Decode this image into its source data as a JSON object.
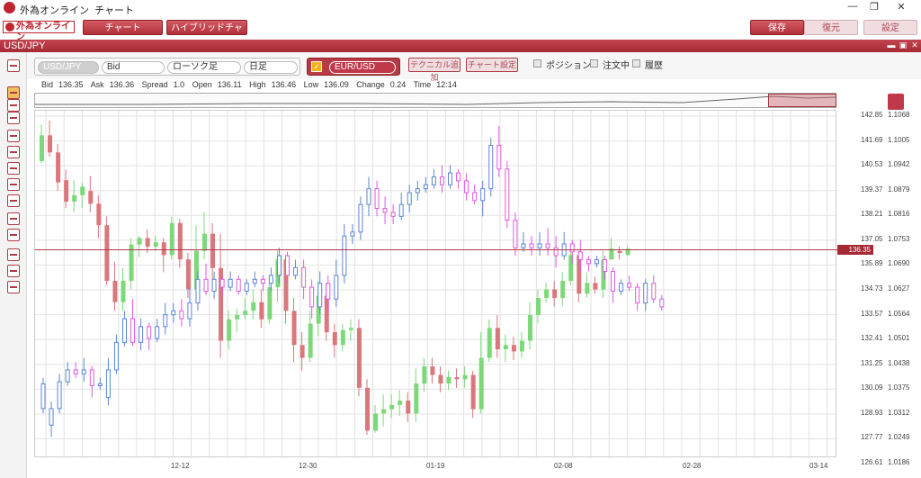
{
  "window": {
    "brand": "外為オンライン",
    "title": "チャート",
    "minimize": "—",
    "maximize": "❐",
    "close": "✕"
  },
  "toolbar": {
    "logo_text": "外為オンライン",
    "chart_tab": "チャート",
    "hybrid_tab": "ハイブリッドチャート",
    "save": "保存",
    "restore": "復元",
    "settings": "設定"
  },
  "chart_window": {
    "title": "USD/JPY"
  },
  "options": {
    "pair": "USD/JPY",
    "price_side": "Bid",
    "chart_type": "ローソク足",
    "period": "日足",
    "compare_pair": "EUR/USD",
    "add_technical": "テクニカル追加",
    "chart_settings": "チャート設定",
    "position": "ポジション",
    "orders": "注文中",
    "history": "履歴"
  },
  "info": {
    "bid_label": "Bid",
    "bid": "136.35",
    "ask_label": "Ask",
    "ask": "136.36",
    "spread_label": "Spread",
    "spread": "1.0",
    "open_label": "Open",
    "open": "136.11",
    "high_label": "High",
    "high": "136.46",
    "low_label": "Low",
    "low": "136.09",
    "change_label": "Change",
    "change": "0.24",
    "time_label": "Time",
    "time": "12:14"
  },
  "current_price": "136.35",
  "colors": {
    "up": "#7dd87a",
    "down": "#d9777c",
    "compare_up": "#5b86d6",
    "compare_down": "#e05ae0",
    "price_line": "#b03a4a"
  },
  "chart_data": {
    "type": "candlestick",
    "x_ticks": [
      "12-12",
      "12-30",
      "01-19",
      "02-08",
      "02-28",
      "03-14"
    ],
    "y_left_ticks": [
      "142.85",
      "141.69",
      "140.53",
      "139.37",
      "138.21",
      "137.05",
      "135.89",
      "134.73",
      "133.57",
      "132.41",
      "131.25",
      "130.09",
      "128.93",
      "127.77",
      "126.61"
    ],
    "y_right_ticks": [
      "1.1068",
      "1.1005",
      "1.0942",
      "1.0879",
      "1.0816",
      "1.0753",
      "1.0690",
      "1.0627",
      "1.0564",
      "1.0501",
      "1.0438",
      "1.0375",
      "1.0312",
      "1.0249",
      "1.0186"
    ],
    "ylim": [
      126.61,
      142.85
    ],
    "usdjpy": [
      [
        140.5,
        141.7,
        142.2,
        140.4
      ],
      [
        141.7,
        140.9,
        142.4,
        140.7
      ],
      [
        140.9,
        139.5,
        141.3,
        139.1
      ],
      [
        139.6,
        138.6,
        140.1,
        138.3
      ],
      [
        138.6,
        138.9,
        139.6,
        138.1
      ],
      [
        138.9,
        139.3,
        139.5,
        138.3
      ],
      [
        139.1,
        138.5,
        139.8,
        138.1
      ],
      [
        138.5,
        137.5,
        138.9,
        136.9
      ],
      [
        137.5,
        134.9,
        137.9,
        134.7
      ],
      [
        134.9,
        133.9,
        135.8,
        133.5
      ],
      [
        133.9,
        134.9,
        135.5,
        133.5
      ],
      [
        134.9,
        136.6,
        136.9,
        134.5
      ],
      [
        136.6,
        136.9,
        137.0,
        136.0
      ],
      [
        136.9,
        136.5,
        137.3,
        136.2
      ],
      [
        136.5,
        136.7,
        137.0,
        136.3
      ],
      [
        136.7,
        136.1,
        136.9,
        135.3
      ],
      [
        136.1,
        137.6,
        137.9,
        135.9
      ],
      [
        137.6,
        135.9,
        137.8,
        135.5
      ],
      [
        135.9,
        134.5,
        136.2,
        134.1
      ],
      [
        134.5,
        136.3,
        137.5,
        134.3
      ],
      [
        136.3,
        137.1,
        138.1,
        135.9
      ],
      [
        137.1,
        135.5,
        137.6,
        134.5
      ],
      [
        135.5,
        132.1,
        137.1,
        131.3
      ],
      [
        132.1,
        133.1,
        133.5,
        131.7
      ],
      [
        133.1,
        133.3,
        133.6,
        132.5
      ],
      [
        133.3,
        133.5,
        134.1,
        133.1
      ],
      [
        133.5,
        133.9,
        134.5,
        133.1
      ],
      [
        133.9,
        133.1,
        134.5,
        132.7
      ],
      [
        133.1,
        134.6,
        135.1,
        132.9
      ],
      [
        134.6,
        135.9,
        136.3,
        133.9
      ],
      [
        135.9,
        133.5,
        136.1,
        132.9
      ],
      [
        133.5,
        131.9,
        134.1,
        131.1
      ],
      [
        131.9,
        131.3,
        132.5,
        130.7
      ],
      [
        131.3,
        132.9,
        133.5,
        131.1
      ],
      [
        132.9,
        134.2,
        134.9,
        132.3
      ],
      [
        134.2,
        132.5,
        134.8,
        132.1
      ],
      [
        132.5,
        131.9,
        132.9,
        131.3
      ],
      [
        131.9,
        132.6,
        132.9,
        131.6
      ],
      [
        132.6,
        132.7,
        133.1,
        132.1
      ],
      [
        132.7,
        129.9,
        133.1,
        129.5
      ],
      [
        129.9,
        127.9,
        130.3,
        127.7
      ],
      [
        127.9,
        128.7,
        129.1,
        127.8
      ],
      [
        128.7,
        128.9,
        129.6,
        128.1
      ],
      [
        128.9,
        129.1,
        129.6,
        128.5
      ],
      [
        129.1,
        129.3,
        129.8,
        128.6
      ],
      [
        129.3,
        128.7,
        129.7,
        128.3
      ],
      [
        128.7,
        130.1,
        130.8,
        128.3
      ],
      [
        130.1,
        130.9,
        131.3,
        129.7
      ],
      [
        130.9,
        130.5,
        131.3,
        130.1
      ],
      [
        130.5,
        130.1,
        130.9,
        129.7
      ],
      [
        130.1,
        130.4,
        130.7,
        129.8
      ],
      [
        130.4,
        130.3,
        130.8,
        129.9
      ],
      [
        130.3,
        130.5,
        130.9,
        129.9
      ],
      [
        130.5,
        128.9,
        130.7,
        128.5
      ],
      [
        128.9,
        131.3,
        132.5,
        128.7
      ],
      [
        131.3,
        132.7,
        133.1,
        131.1
      ],
      [
        132.7,
        131.7,
        133.3,
        131.3
      ],
      [
        131.7,
        131.9,
        132.4,
        131.1
      ],
      [
        131.9,
        131.6,
        132.3,
        131.2
      ],
      [
        131.6,
        132.1,
        132.5,
        131.3
      ],
      [
        132.1,
        133.3,
        133.9,
        131.7
      ],
      [
        133.3,
        134.1,
        134.5,
        132.9
      ],
      [
        134.1,
        134.5,
        134.8,
        133.9
      ],
      [
        134.5,
        134.1,
        134.9,
        133.7
      ],
      [
        134.1,
        134.9,
        135.3,
        133.7
      ],
      [
        134.9,
        136.1,
        136.3,
        134.7
      ],
      [
        136.1,
        134.3,
        136.3,
        133.9
      ],
      [
        134.3,
        134.8,
        135.3,
        134.1
      ],
      [
        134.8,
        134.5,
        135.1,
        134.3
      ],
      [
        134.5,
        135.9,
        136.3,
        134.1
      ],
      [
        135.9,
        136.4,
        136.9,
        135.9
      ],
      [
        136.3,
        136.2,
        136.5,
        135.9
      ],
      [
        136.1,
        136.4,
        136.5,
        136.1
      ]
    ],
    "eurusd": [
      [
        1.0312,
        1.0375,
        1.039,
        1.03
      ],
      [
        1.027,
        1.0312,
        1.033,
        1.024
      ],
      [
        1.0312,
        1.038,
        1.04,
        1.03
      ],
      [
        1.038,
        1.041,
        1.043,
        1.037
      ],
      [
        1.041,
        1.04,
        1.043,
        1.039
      ],
      [
        1.04,
        1.041,
        1.044,
        1.038
      ],
      [
        1.041,
        1.037,
        1.042,
        1.034
      ],
      [
        1.037,
        1.0375,
        1.039,
        1.036
      ],
      [
        1.034,
        1.041,
        1.044,
        1.032
      ],
      [
        1.041,
        1.048,
        1.05,
        1.04
      ],
      [
        1.048,
        1.054,
        1.056,
        1.047
      ],
      [
        1.054,
        1.048,
        1.059,
        1.047
      ],
      [
        1.048,
        1.052,
        1.054,
        1.046
      ],
      [
        1.052,
        1.049,
        1.053,
        1.046
      ],
      [
        1.049,
        1.052,
        1.054,
        1.048
      ],
      [
        1.052,
        1.055,
        1.058,
        1.05
      ],
      [
        1.055,
        1.056,
        1.058,
        1.053
      ],
      [
        1.056,
        1.054,
        1.059,
        1.052
      ],
      [
        1.054,
        1.058,
        1.062,
        1.052
      ],
      [
        1.058,
        1.064,
        1.066,
        1.056
      ],
      [
        1.064,
        1.061,
        1.068,
        1.06
      ],
      [
        1.061,
        1.064,
        1.066,
        1.059
      ],
      [
        1.064,
        1.062,
        1.065,
        1.06
      ],
      [
        1.062,
        1.064,
        1.066,
        1.061
      ],
      [
        1.064,
        1.061,
        1.065,
        1.06
      ],
      [
        1.061,
        1.063,
        1.064,
        1.06
      ],
      [
        1.063,
        1.064,
        1.066,
        1.062
      ],
      [
        1.064,
        1.063,
        1.065,
        1.061
      ],
      [
        1.063,
        1.065,
        1.067,
        1.061
      ],
      [
        1.065,
        1.07,
        1.072,
        1.063
      ],
      [
        1.07,
        1.065,
        1.071,
        1.063
      ],
      [
        1.065,
        1.067,
        1.069,
        1.064
      ],
      [
        1.067,
        1.062,
        1.069,
        1.059
      ],
      [
        1.062,
        1.057,
        1.064,
        1.054
      ],
      [
        1.057,
        1.063,
        1.066,
        1.055
      ],
      [
        1.063,
        1.059,
        1.065,
        1.056
      ],
      [
        1.059,
        1.065,
        1.069,
        1.057
      ],
      [
        1.065,
        1.075,
        1.078,
        1.063
      ],
      [
        1.075,
        1.076,
        1.078,
        1.073
      ],
      [
        1.076,
        1.083,
        1.085,
        1.074
      ],
      [
        1.083,
        1.087,
        1.09,
        1.08
      ],
      [
        1.087,
        1.082,
        1.089,
        1.08
      ],
      [
        1.082,
        1.081,
        1.085,
        1.078
      ],
      [
        1.081,
        1.08,
        1.083,
        1.078
      ],
      [
        1.08,
        1.083,
        1.086,
        1.079
      ],
      [
        1.083,
        1.086,
        1.088,
        1.081
      ],
      [
        1.086,
        1.087,
        1.089,
        1.084
      ],
      [
        1.087,
        1.088,
        1.09,
        1.086
      ],
      [
        1.088,
        1.09,
        1.092,
        1.087
      ],
      [
        1.09,
        1.088,
        1.093,
        1.086
      ],
      [
        1.088,
        1.091,
        1.093,
        1.087
      ],
      [
        1.091,
        1.089,
        1.092,
        1.087
      ],
      [
        1.089,
        1.086,
        1.091,
        1.084
      ],
      [
        1.086,
        1.084,
        1.088,
        1.083
      ],
      [
        1.084,
        1.087,
        1.089,
        1.08
      ],
      [
        1.087,
        1.098,
        1.1,
        1.085
      ],
      [
        1.098,
        1.092,
        1.103,
        1.09
      ],
      [
        1.092,
        1.079,
        1.094,
        1.077
      ],
      [
        1.079,
        1.072,
        1.081,
        1.07
      ],
      [
        1.072,
        1.073,
        1.076,
        1.071
      ],
      [
        1.073,
        1.072,
        1.075,
        1.07
      ],
      [
        1.072,
        1.073,
        1.076,
        1.07
      ],
      [
        1.073,
        1.072,
        1.077,
        1.07
      ],
      [
        1.072,
        1.07,
        1.075,
        1.067
      ],
      [
        1.07,
        1.073,
        1.076,
        1.069
      ],
      [
        1.073,
        1.071,
        1.074,
        1.068
      ],
      [
        1.071,
        1.069,
        1.074,
        1.066
      ],
      [
        1.069,
        1.068,
        1.07,
        1.066
      ],
      [
        1.068,
        1.069,
        1.07,
        1.067
      ],
      [
        1.069,
        1.066,
        1.07,
        1.064
      ],
      [
        1.066,
        1.061,
        1.067,
        1.058
      ],
      [
        1.061,
        1.063,
        1.064,
        1.06
      ],
      [
        1.063,
        1.062,
        1.065,
        1.061
      ],
      [
        1.062,
        1.058,
        1.063,
        1.056
      ],
      [
        1.058,
        1.063,
        1.064,
        1.056
      ],
      [
        1.063,
        1.059,
        1.065,
        1.058
      ],
      [
        1.059,
        1.057,
        1.06,
        1.056
      ]
    ]
  }
}
